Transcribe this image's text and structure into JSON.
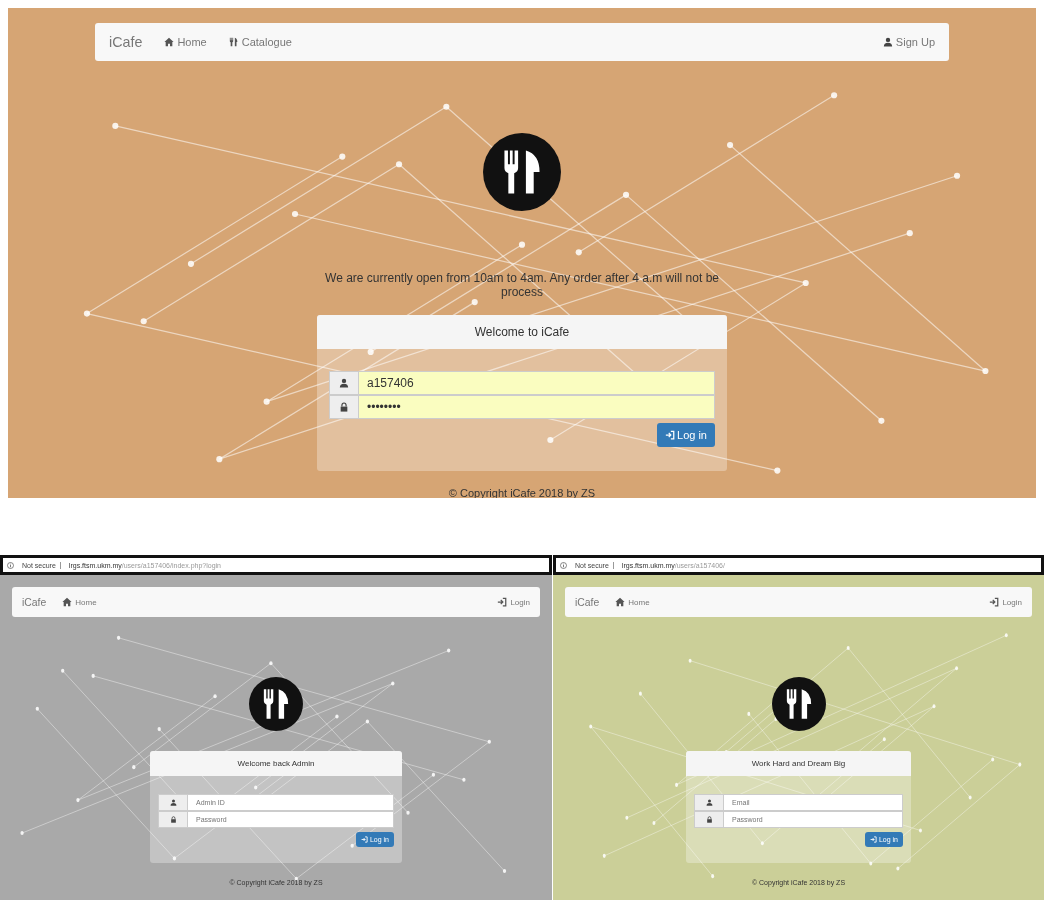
{
  "screens": [
    {
      "color": "#d6a574",
      "nav": {
        "brand": "iCafe",
        "links": [
          {
            "label": "Home"
          },
          {
            "label": "Catalogue"
          }
        ],
        "right": {
          "kind": "signup",
          "label": "Sign Up"
        }
      },
      "notice": "We are currently open from 10am to 4am. Any order after 4 a.m will not be process",
      "login": {
        "title": "Welcome to iCafe",
        "fields": [
          {
            "value": "a157406",
            "autofilled": true
          },
          {
            "value": "••••••••",
            "autofilled": true
          }
        ],
        "button": "Log in"
      },
      "footer": "© Copyright iCafe 2018 by ZS"
    },
    {
      "color": "#a9a9a9",
      "address_bar": {
        "security": "Not secure",
        "domain": "lrgs.ftsm.ukm.my",
        "path": "/users/a157406/index.php?login"
      },
      "nav": {
        "brand": "iCafe",
        "links": [
          {
            "label": "Home"
          }
        ],
        "right": {
          "kind": "login",
          "label": "Login"
        }
      },
      "login": {
        "title": "Welcome back Admin",
        "fields": [
          {
            "placeholder": "Admin ID",
            "autofilled": false
          },
          {
            "placeholder": "Password",
            "autofilled": false
          }
        ],
        "button": "Log in"
      },
      "footer": "© Copyright iCafe 2018 by ZS"
    },
    {
      "color": "#cbcf98",
      "address_bar": {
        "security": "Not secure",
        "domain": "lrgs.ftsm.ukm.my",
        "path": "/users/a157406/"
      },
      "nav": {
        "brand": "iCafe",
        "links": [
          {
            "label": "Home"
          }
        ],
        "right": {
          "kind": "login",
          "label": "Login"
        }
      },
      "login": {
        "title": "Work Hard and Dream Big",
        "fields": [
          {
            "placeholder": "Email",
            "autofilled": false
          },
          {
            "placeholder": "Password",
            "autofilled": false
          }
        ],
        "button": "Log in"
      },
      "footer": "© Copyright iCafe 2018 by ZS"
    }
  ]
}
